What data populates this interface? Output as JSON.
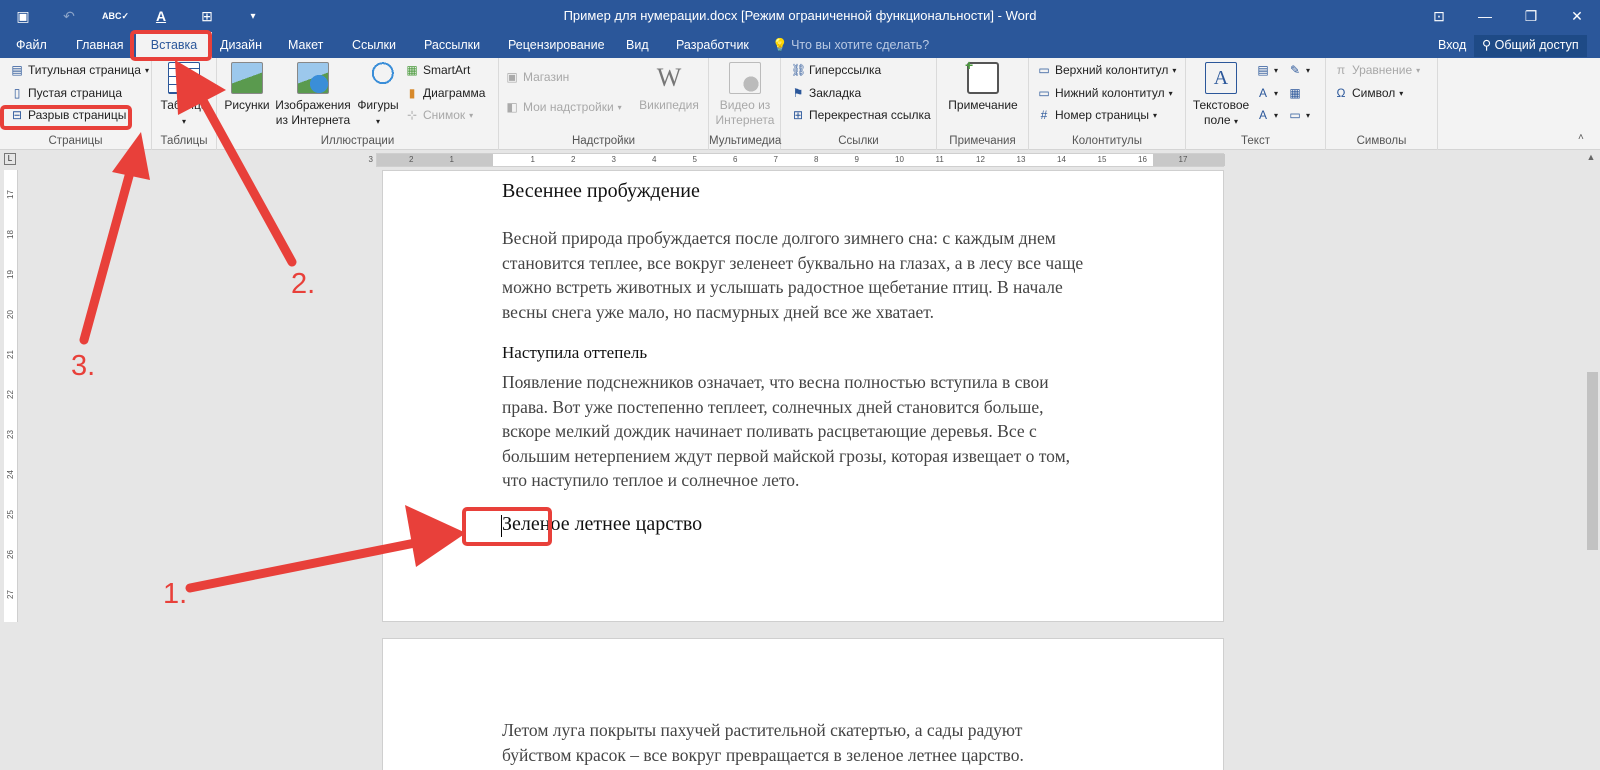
{
  "window": {
    "title": "Пример для нумерации.docx [Режим ограниченной функциональности] - Word"
  },
  "tabs": [
    {
      "label": "Файл"
    },
    {
      "label": "Главная"
    },
    {
      "label": "Вставка",
      "active": true
    },
    {
      "label": "Дизайн"
    },
    {
      "label": "Макет"
    },
    {
      "label": "Ссылки"
    },
    {
      "label": "Рассылки"
    },
    {
      "label": "Рецензирование"
    },
    {
      "label": "Вид"
    },
    {
      "label": "Разработчик"
    }
  ],
  "tell_me": "Что вы хотите сделать?",
  "account": {
    "sign_in": "Вход",
    "share": "Общий доступ"
  },
  "ribbon": {
    "pages": {
      "label": "Страницы",
      "cover_page": "Титульная страница",
      "blank_page": "Пустая страница",
      "page_break": "Разрыв страницы"
    },
    "tables": {
      "label": "Таблицы",
      "table": "Таблица"
    },
    "illustrations": {
      "label": "Иллюстрации",
      "pictures": "Рисунки",
      "online_pictures_1": "Изображения",
      "online_pictures_2": "из Интернета",
      "shapes": "Фигуры",
      "smartart": "SmartArt",
      "chart": "Диаграмма",
      "screenshot": "Снимок"
    },
    "addins": {
      "label": "Надстройки",
      "store": "Магазин",
      "my_addins": "Мои надстройки",
      "wikipedia": "Википедия"
    },
    "media": {
      "label": "Мультимедиа",
      "online_video_1": "Видео из",
      "online_video_2": "Интернета"
    },
    "links": {
      "label": "Ссылки",
      "hyperlink": "Гиперссылка",
      "bookmark": "Закладка",
      "cross_reference": "Перекрестная ссылка"
    },
    "comments": {
      "label": "Примечания",
      "comment": "Примечание"
    },
    "header_footer": {
      "label": "Колонтитулы",
      "header": "Верхний колонтитул",
      "footer": "Нижний колонтитул",
      "page_number": "Номер страницы"
    },
    "text": {
      "label": "Текст",
      "textbox_1": "Текстовое",
      "textbox_2": "поле"
    },
    "symbols": {
      "label": "Символы",
      "equation": "Уравнение",
      "symbol": "Символ"
    }
  },
  "ruler": {
    "h_labels": [
      "3",
      "2",
      "1",
      "1",
      "2",
      "3",
      "4",
      "5",
      "6",
      "7",
      "8",
      "9",
      "10",
      "11",
      "12",
      "13",
      "14",
      "15",
      "16",
      "17"
    ],
    "v_labels": [
      "17",
      "18",
      "19",
      "20",
      "21",
      "22",
      "23",
      "24",
      "25",
      "26",
      "27"
    ]
  },
  "document": {
    "page1": {
      "heading1": "Весеннее пробуждение",
      "para1": [
        "Весной природа пробуждается после долгого зимнего сна: с каждым днем",
        "становится теплее, все вокруг зеленеет буквально на глазах, а в лесу все чаще",
        "можно встреть животных и услышать радостное щебетание птиц. В начале",
        "весны снега уже мало, но пасмурных дней все же хватает."
      ],
      "heading2": "Наступила оттепель",
      "para2": [
        "Появление подснежников означает, что весна полностью вступила в свои",
        "права. Вот уже постепенно теплеет, солнечных дней становится больше,",
        "вскоре мелкий дождик начинает поливать расцветающие деревья. Все с",
        "большим нетерпением ждут первой майской грозы, которая извещает о том,",
        "что наступило теплое и солнечное лето."
      ],
      "heading3": "Зеленое летнее царство"
    },
    "page2": {
      "para": [
        "Летом луга покрыты пахучей растительной скатертью, а сады радуют",
        "буйством красок – все вокруг превращается в зеленое летнее царство."
      ]
    }
  },
  "annotations": {
    "step1": "1.",
    "step2": "2.",
    "step3": "3.",
    "color": "#e8403a"
  },
  "colors": {
    "word_blue": "#2b579a",
    "ribbon_bg": "#f3f3f3",
    "canvas_bg": "#e6e6e6"
  }
}
